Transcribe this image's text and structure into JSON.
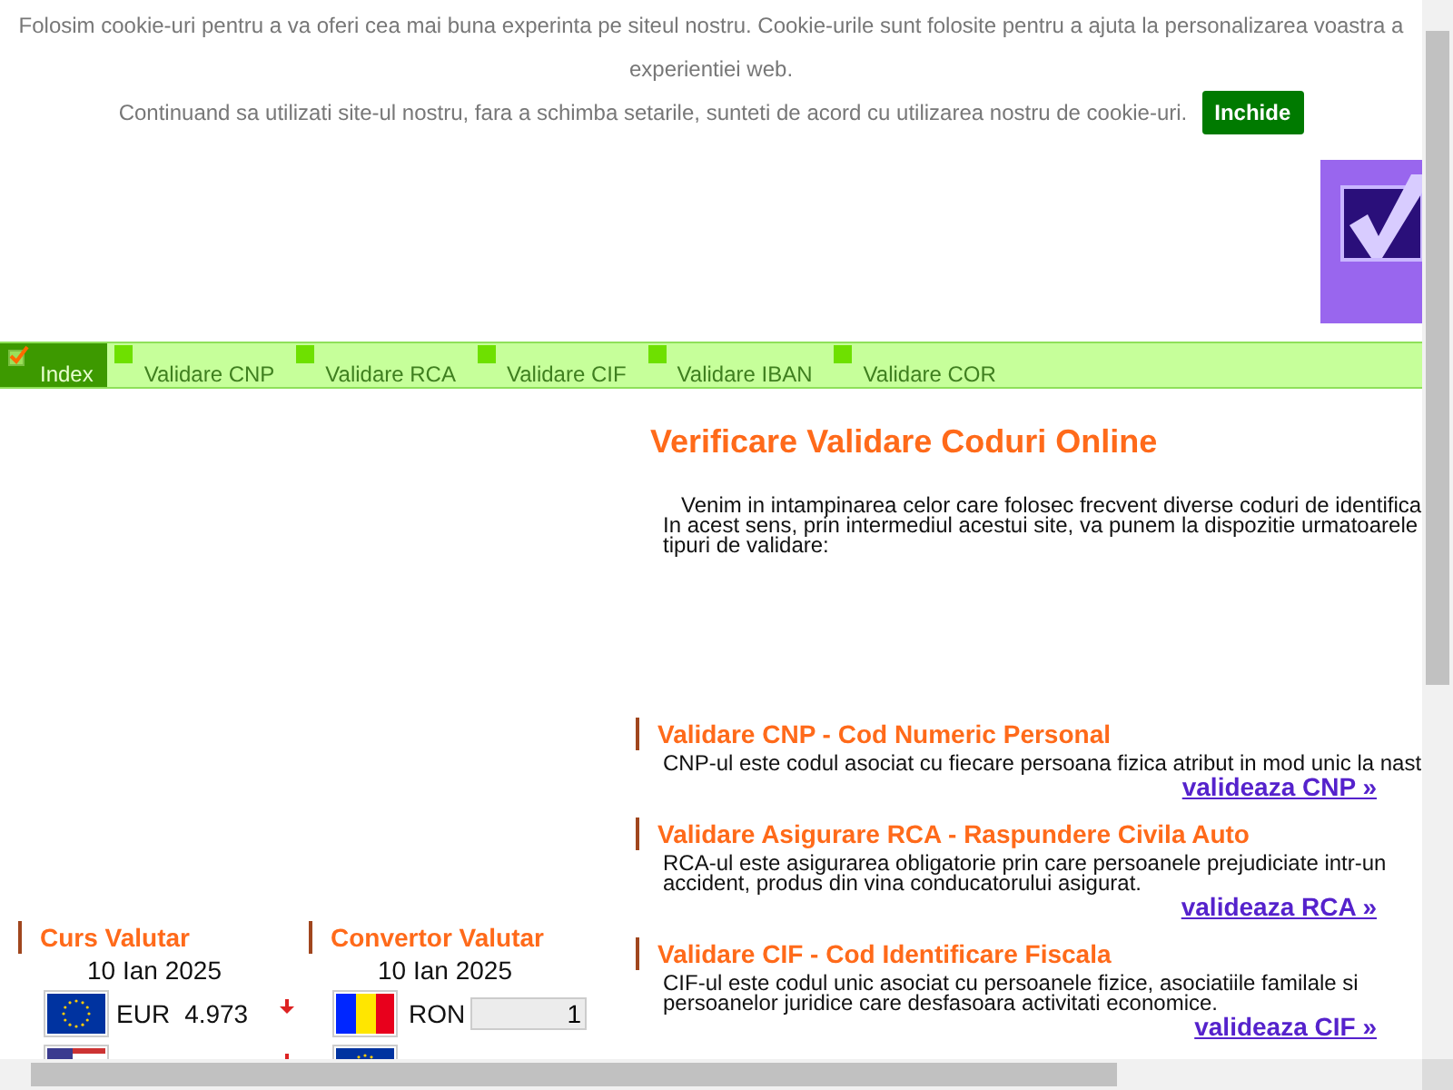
{
  "cookie_banner": {
    "lines": [
      "Folosim cookie-uri pentru a va oferi cea mai buna experinta pe siteul nostru. Cookie-urile sunt folosite pentru a ajuta la personalizarea voastra a experientiei web.",
      "Continuand sa utilizati site-ul nostru, fara a schimba setarile, sunteti de acord cu utilizarea nostru de cookie-uri."
    ],
    "button": "Inchide"
  },
  "nav": [
    {
      "label": "Index",
      "selected": true
    },
    {
      "label": "Validare CNP",
      "selected": false
    },
    {
      "label": "Validare RCA",
      "selected": false
    },
    {
      "label": "Validare CIF",
      "selected": false
    },
    {
      "label": "Validare IBAN",
      "selected": false
    },
    {
      "label": "Validare COR",
      "selected": false
    }
  ],
  "main": {
    "title": "Verificare Validare Coduri Online",
    "intro": [
      "Venim in intampinarea celor care folosec frecvent diverse coduri de identifica",
      "In acest sens, prin intermediul acestui site, va punem la dispozitie urmatoarele",
      "tipuri de validare:"
    ],
    "sections": [
      {
        "title": "Validare CNP - Cod Numeric Personal",
        "text": [
          "CNP-ul este codul asociat cu fiecare persoana fizica atribut in mod unic la nast"
        ],
        "link": "valideaza CNP »"
      },
      {
        "title": "Validare Asigurare RCA - Raspundere Civila Auto",
        "text": [
          "RCA-ul este asigurarea obligatorie prin care persoanele prejudiciate intr-un",
          "accident, produs din vina conducatorului asigurat."
        ],
        "link": "valideaza RCA »"
      },
      {
        "title": "Validare CIF - Cod Identificare Fiscala",
        "text": [
          "CIF-ul este codul unic asociat cu persoanele fizice, asociatiile familale si",
          "persoanelor juridice care desfasoara activitati economice."
        ],
        "link": "valideaza CIF »"
      }
    ]
  },
  "exchange_rates": {
    "title": "Curs Valutar",
    "date": "10 Ian 2025",
    "rows": [
      {
        "kind": "eu",
        "code": "EUR",
        "rate": "4.973"
      },
      {
        "kind": "us"
      }
    ]
  },
  "converter": {
    "title": "Convertor Valutar",
    "date": "10 Ian 2025",
    "rows": [
      {
        "kind": "ro",
        "code": "RON",
        "value": "1"
      },
      {
        "kind": "eu"
      }
    ]
  }
}
